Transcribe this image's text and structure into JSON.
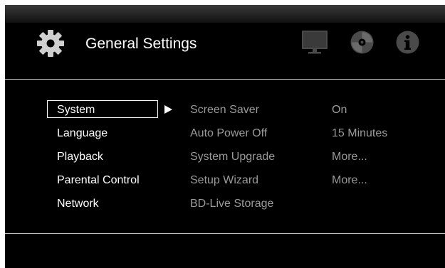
{
  "header": {
    "title": "General Settings",
    "icons": [
      "gear-icon",
      "tv-icon",
      "disc-icon",
      "info-icon"
    ]
  },
  "menu": {
    "items": [
      {
        "label": "System"
      },
      {
        "label": "Language"
      },
      {
        "label": "Playback"
      },
      {
        "label": "Parental Control"
      },
      {
        "label": "Network"
      }
    ],
    "selected": "System"
  },
  "options": [
    {
      "label": "Screen Saver",
      "value": "On"
    },
    {
      "label": "Auto Power Off",
      "value": "15 Minutes"
    },
    {
      "label": "System Upgrade",
      "value": "More..."
    },
    {
      "label": "Setup Wizard",
      "value": "More..."
    },
    {
      "label": "BD-Live Storage",
      "value": ""
    }
  ],
  "colors": {
    "background": "#000000",
    "text": "#ffffff",
    "dim_text": "#9a9a9a",
    "divider": "#bdbdbd"
  }
}
